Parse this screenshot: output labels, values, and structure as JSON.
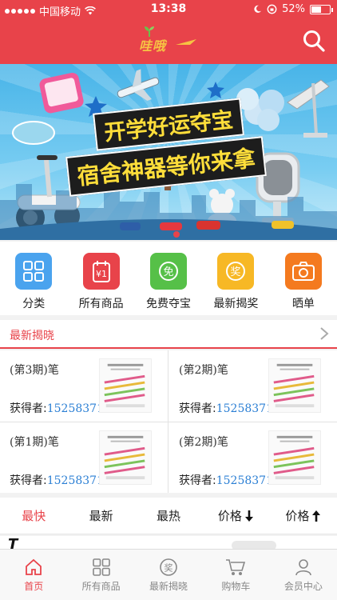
{
  "status_bar": {
    "carrier": "中国移动",
    "time": "13:38",
    "battery": "52%"
  },
  "header": {
    "logo_text": "哇哦",
    "search_icon": "search-icon"
  },
  "banner": {
    "line1": "开学好运夺宝",
    "line2": "宿舍神器等你来拿"
  },
  "categories": [
    {
      "label": "分类",
      "icon": "grid-icon",
      "color": "#4aa3ee"
    },
    {
      "label": "所有商品",
      "icon": "price-tag-icon",
      "color": "#e8434a"
    },
    {
      "label": "免费夺宝",
      "icon": "free-icon",
      "color": "#56c048"
    },
    {
      "label": "最新揭奖",
      "icon": "prize-icon",
      "color": "#f7b825"
    },
    {
      "label": "晒单",
      "icon": "camera-icon",
      "color": "#f47a1f"
    }
  ],
  "latest_reveal": {
    "title": "最新揭晓",
    "items": [
      {
        "period": "(第3期)笔",
        "winner_label": "获得者:",
        "winner": "15258371*"
      },
      {
        "period": "(第2期)笔",
        "winner_label": "获得者:",
        "winner": "15258371*"
      },
      {
        "period": "(第1期)笔",
        "winner_label": "获得者:",
        "winner": "15258371*"
      },
      {
        "period": "(第2期)笔",
        "winner_label": "获得者:",
        "winner": "15258371*"
      }
    ]
  },
  "sort_tabs": [
    {
      "label": "最快",
      "active": true
    },
    {
      "label": "最新"
    },
    {
      "label": "最热"
    },
    {
      "label": "价格",
      "arrow": "down"
    },
    {
      "label": "价格",
      "arrow": "up"
    }
  ],
  "bottom_nav": [
    {
      "label": "首页",
      "icon": "home-icon",
      "active": true
    },
    {
      "label": "所有商品",
      "icon": "grid-icon"
    },
    {
      "label": "最新揭晓",
      "icon": "prize-icon"
    },
    {
      "label": "购物车",
      "icon": "cart-icon"
    },
    {
      "label": "会员中心",
      "icon": "user-icon"
    }
  ],
  "colors": {
    "brand": "#e8434a",
    "link": "#2b7fd4"
  }
}
